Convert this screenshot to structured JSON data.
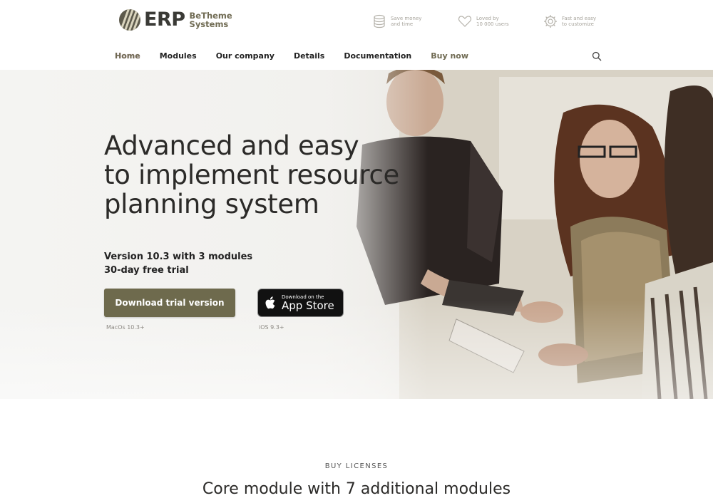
{
  "brand": {
    "name": "ERP",
    "sub_line1": "BeTheme",
    "sub_line2": "Systems"
  },
  "features": [
    {
      "icon": "database-icon",
      "line1": "Save money",
      "line2": "and time"
    },
    {
      "icon": "heart-icon",
      "line1": "Loved by",
      "line2": "10 000 users"
    },
    {
      "icon": "gear-icon",
      "line1": "Fast and easy",
      "line2": "to customize"
    }
  ],
  "nav": {
    "items": [
      "Home",
      "Modules",
      "Our company",
      "Details",
      "Documentation",
      "Buy now"
    ],
    "active": "Home"
  },
  "hero": {
    "title_line1": "Advanced and easy",
    "title_line2": "to implement resource",
    "title_line3": "planning system",
    "sub_line1": "Version 10.3 with 3 modules",
    "sub_line2": "30-day free trial",
    "trial_button": "Download trial version",
    "trial_note": "MacOs 10.3+",
    "store_small": "Download on the",
    "store_big": "App Store",
    "store_note": "iOS 9.3+"
  },
  "licenses": {
    "label": "BUY LICENSES",
    "title": "Core module with 7 additional modules"
  },
  "colors": {
    "accent": "#6e6a4d",
    "text": "#2b2a28",
    "store_button": "#111111"
  }
}
